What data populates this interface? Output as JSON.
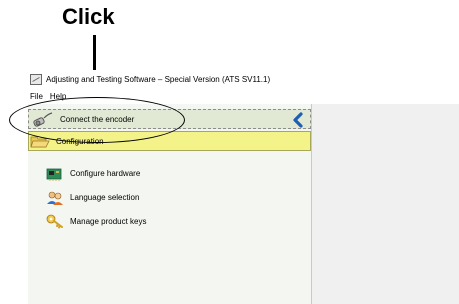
{
  "annotation": {
    "click_label": "Click"
  },
  "window": {
    "title": "Adjusting and Testing Software – Special Version (ATS SV11.1)"
  },
  "menu": {
    "items": [
      "File",
      "Help"
    ]
  },
  "tree": {
    "connect_label": "Connect the encoder",
    "config_label": "Configuration",
    "items": [
      {
        "label": "Configure hardware",
        "icon": "hardware-board-icon"
      },
      {
        "label": "Language selection",
        "icon": "users-icon"
      },
      {
        "label": "Manage product keys",
        "icon": "key-icon"
      }
    ]
  },
  "colors": {
    "connect_bg": "#e1e9d4",
    "config_bg": "#f3f38a",
    "accent_blue": "#1e5fb4"
  }
}
